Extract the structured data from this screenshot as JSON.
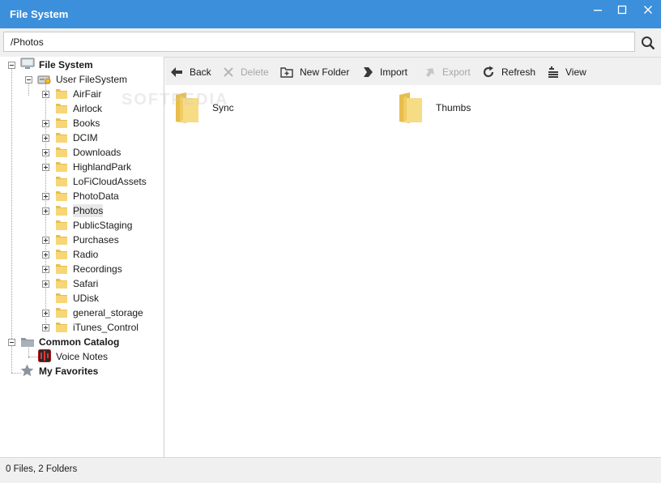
{
  "window": {
    "title": "File System"
  },
  "pathbar": {
    "path_value": "/Photos"
  },
  "tree": {
    "root": "File System",
    "user_filesystem": "User FileSystem",
    "folders": [
      "AirFair",
      "Airlock",
      "Books",
      "DCIM",
      "Downloads",
      "HighlandPark",
      "LoFiCloudAssets",
      "PhotoData",
      "Photos",
      "PublicStaging",
      "Purchases",
      "Radio",
      "Recordings",
      "Safari",
      "UDisk",
      "general_storage",
      "iTunes_Control"
    ],
    "common_catalog": "Common Catalog",
    "voice_notes": "Voice Notes",
    "my_favorites": "My Favorites"
  },
  "toolbar": {
    "back": "Back",
    "delete": "Delete",
    "new_folder": "New Folder",
    "import": "Import",
    "export": "Export",
    "refresh": "Refresh",
    "view": "View"
  },
  "content": {
    "items": [
      "Sync",
      "Thumbs"
    ]
  },
  "status": {
    "text": "0 Files, 2 Folders"
  },
  "colors": {
    "titlebar": "#3c8fdb",
    "folder": "#f5d36e",
    "toolbar_bg": "#f0f0f0"
  }
}
